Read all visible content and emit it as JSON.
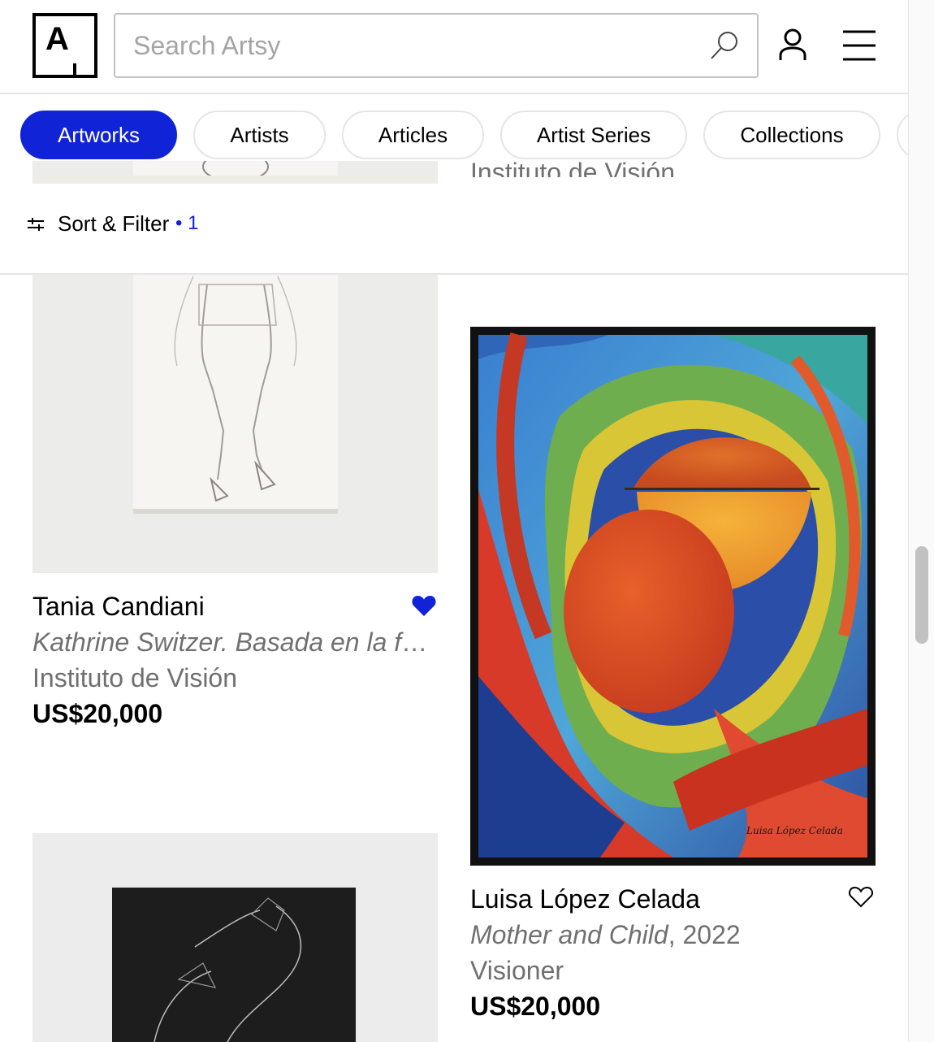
{
  "header": {
    "logo_letter": "A",
    "search_placeholder": "Search Artsy"
  },
  "tabs": [
    {
      "label": "Artworks",
      "active": true
    },
    {
      "label": "Artists",
      "active": false
    },
    {
      "label": "Articles",
      "active": false
    },
    {
      "label": "Artist Series",
      "active": false
    },
    {
      "label": "Collections",
      "active": false
    }
  ],
  "filter": {
    "label": "Sort & Filter",
    "count": "• 1"
  },
  "partial_above": {
    "partner": "Instituto de Visión"
  },
  "artworks": [
    {
      "artist": "Tania Candiani",
      "title": "Kathrine Switzer. Basada en la fot...",
      "year": "",
      "partner": "Instituto de Visión",
      "price": "US$20,000",
      "saved": true
    },
    {
      "artist": "Luisa López Celada",
      "title": "Mother and Child",
      "year": ", 2022",
      "partner": "Visioner",
      "price": "US$20,000",
      "saved": false,
      "signature": "Luisa López Celada"
    }
  ],
  "colors": {
    "accent": "#1023d7",
    "muted_text": "#707070",
    "border": "#e5e5e5"
  }
}
